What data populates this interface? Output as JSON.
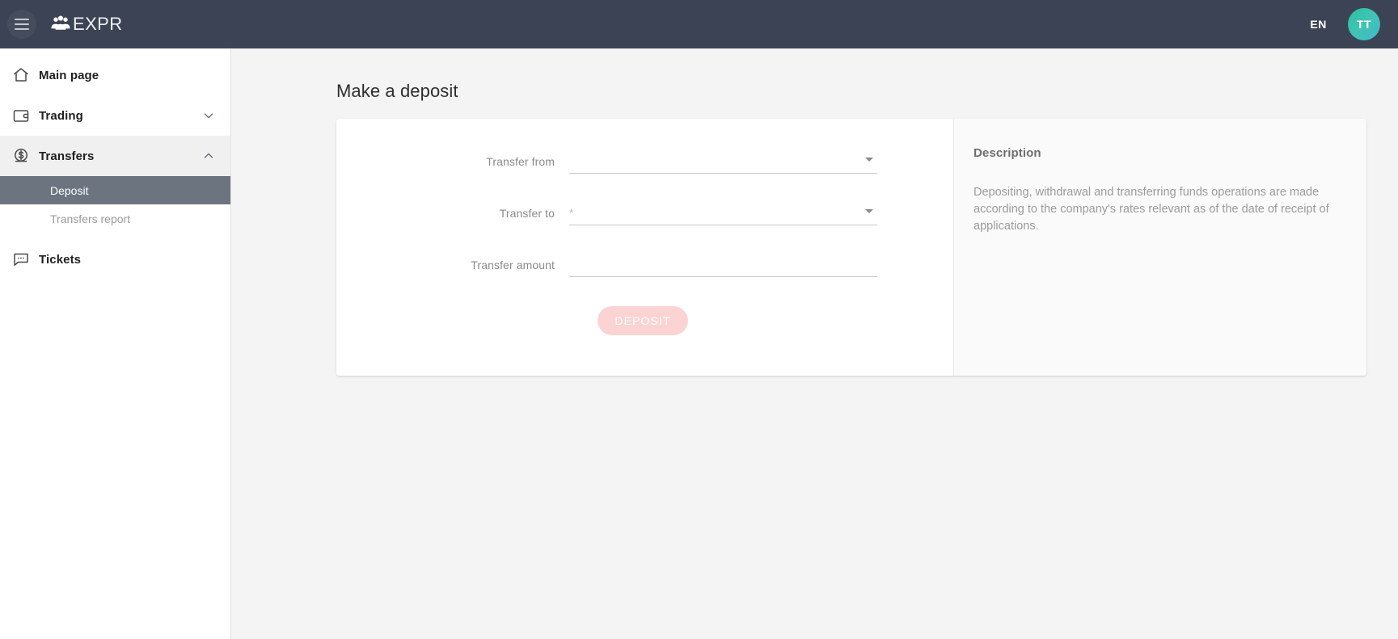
{
  "topbar": {
    "menu_icon": "hamburger-menu-icon",
    "brand_icon": "people-group-icon",
    "brand": "EXPR",
    "language": "EN",
    "avatar_initials": "TT",
    "accent_dark": "#3b4354",
    "avatar_gradient_from": "#2fbfa0",
    "avatar_gradient_to": "#43b9c9"
  },
  "sidebar": {
    "items": [
      {
        "label": "Main page",
        "icon": "home-icon",
        "expandable": false,
        "state": "default"
      },
      {
        "label": "Trading",
        "icon": "wallet-icon",
        "expandable": true,
        "chevron": "chevron-down-icon",
        "state": "collapsed"
      },
      {
        "label": "Transfers",
        "icon": "dollar-circle-icon",
        "expandable": true,
        "chevron": "chevron-up-icon",
        "state": "expanded"
      },
      {
        "label": "Tickets",
        "icon": "chat-bubble-icon",
        "expandable": false,
        "state": "default"
      }
    ],
    "sub_items": [
      {
        "label": "Deposit",
        "selected": true
      },
      {
        "label": "Transfers report",
        "selected": false
      }
    ],
    "active_bg": "#6c7480",
    "expanded_bg": "#f0f0f0"
  },
  "main": {
    "page_title": "Make a deposit",
    "form": {
      "fields": [
        {
          "label": "Transfer from",
          "value": "",
          "placeholder": "",
          "control": "select",
          "arrow_icon": "dropdown-arrow-icon"
        },
        {
          "label": "Transfer to",
          "value": "*",
          "placeholder": "",
          "control": "select",
          "arrow_icon": "dropdown-arrow-icon"
        },
        {
          "label": "Transfer amount",
          "value": "",
          "placeholder": "",
          "control": "text",
          "arrow_icon": ""
        }
      ],
      "submit_label": "DEPOSIT",
      "submit_disabled": true,
      "submit_bg": "#fbd3d3"
    },
    "description": {
      "title": "Description",
      "body": "Depositing, withdrawal and transferring funds operations are made according to the company's rates relevant as of the date of receipt of applications."
    }
  }
}
